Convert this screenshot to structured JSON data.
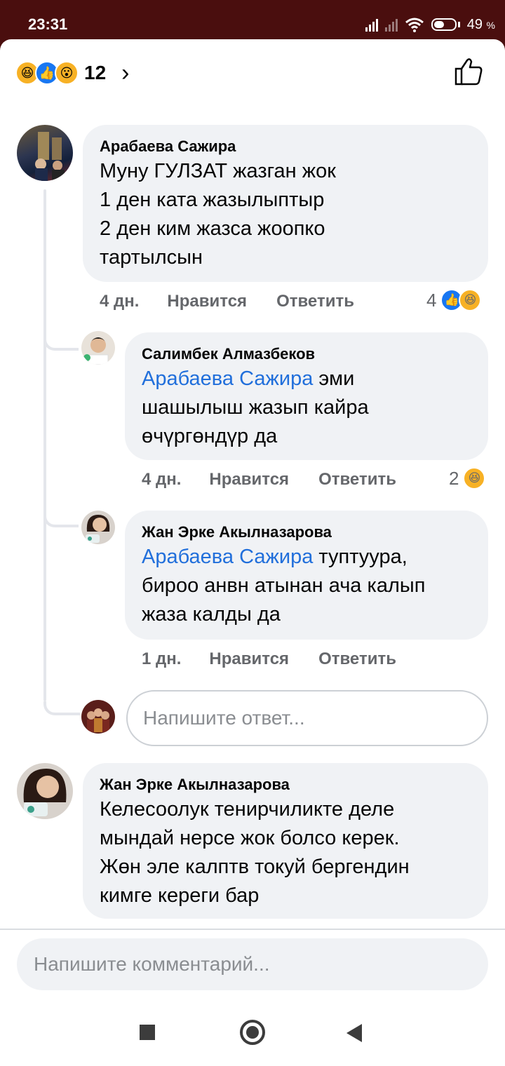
{
  "status_bar": {
    "time": "23:31",
    "battery": "49",
    "battery_unit": "%"
  },
  "reactions_header": {
    "count": "12",
    "icons": [
      "haha-icon",
      "like-icon",
      "wow-icon"
    ]
  },
  "comments": [
    {
      "author": "Арабаева Сажира",
      "text_lines": [
        "Муну ГУЛЗАТ жазган жок",
        "1 ден ката жазылыптыр",
        "2 ден ким жазса жоопко",
        "тартылсын"
      ],
      "time": "4 дн.",
      "like_label": "Нравится",
      "reply_label": "Ответить",
      "reaction_count": "4",
      "replies": [
        {
          "author": "Салимбек Алмазбеков",
          "mention": "Арабаева Сажира",
          "text_first": " эми",
          "text_lines": [
            "шашылыш жазып кайра",
            "өчүргөндүр да"
          ],
          "time": "4 дн.",
          "like_label": "Нравится",
          "reply_label": "Ответить",
          "reaction_count": "2"
        },
        {
          "author": "Жан Эрке Акылназарова",
          "mention": "Арабаева Сажира",
          "text_first": " туптуура,",
          "text_lines": [
            "бироо анвн атынан ача калып",
            "жаза калды да"
          ],
          "time": "1 дн.",
          "like_label": "Нравится",
          "reply_label": "Ответить"
        }
      ],
      "reply_placeholder": "Напишите ответ..."
    },
    {
      "author": "Жан Эрке Акылназарова",
      "text_lines": [
        "Келесоолук тенирчиликте деле",
        "мындай нерсе жок болсо керек.",
        "Жөн эле калптв токуй бергендин",
        "кимге кереги бар"
      ]
    }
  ],
  "comment_input": {
    "placeholder": "Напишите комментарий..."
  },
  "colors": {
    "status_bar": "#4a0e0e",
    "bubble": "#f0f2f5",
    "mention": "#216fdb",
    "meta": "#65676b",
    "like_blue": "#1877f2",
    "haha_yellow": "#f7b125"
  }
}
